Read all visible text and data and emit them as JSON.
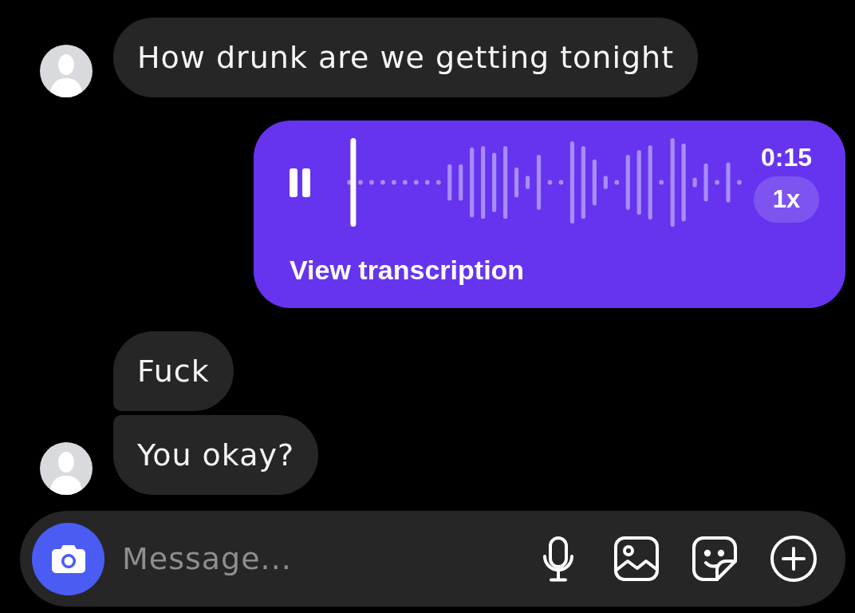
{
  "messages": [
    {
      "kind": "text",
      "outgoing": false,
      "avatar": true,
      "text": "How drunk are we getting tonight"
    },
    {
      "kind": "voice",
      "outgoing": true,
      "playing": true,
      "level": 0.01,
      "duration": "0:15",
      "speed": "1x",
      "link": "View transcription"
    },
    {
      "kind": "text",
      "outgoing": false,
      "avatar": false,
      "text": "Fuck"
    },
    {
      "kind": "text",
      "outgoing": false,
      "avatar": true,
      "text": "You okay?"
    }
  ],
  "composer": {
    "placeholder": "Message..."
  }
}
